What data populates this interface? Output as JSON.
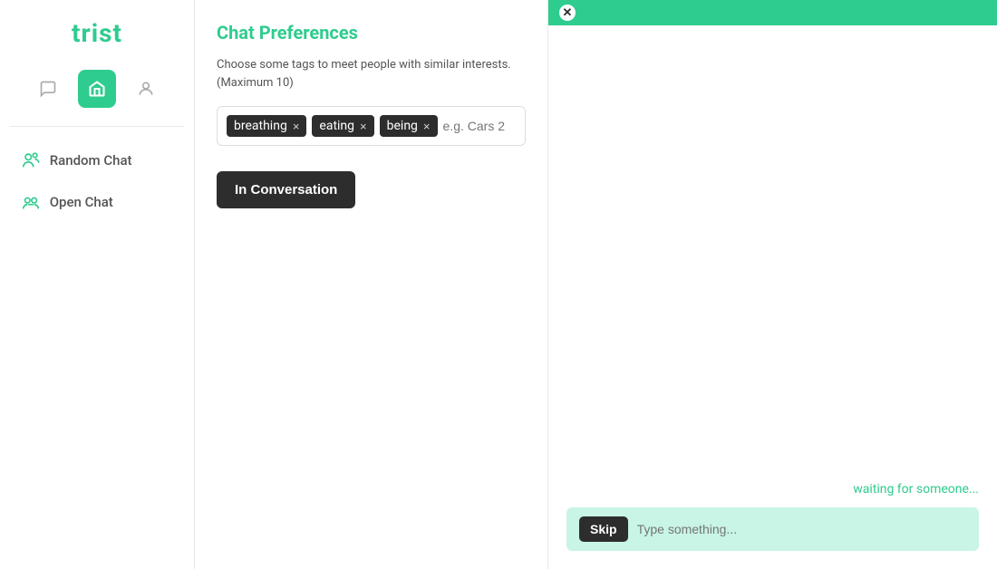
{
  "app": {
    "logo": "trist"
  },
  "sidebar": {
    "nav_items": [
      {
        "id": "random-chat",
        "label": "Random Chat",
        "icon": "user-chat-icon"
      },
      {
        "id": "open-chat",
        "label": "Open Chat",
        "icon": "group-chat-icon"
      }
    ]
  },
  "middle_panel": {
    "title": "Chat Preferences",
    "description": "Choose some tags to meet people with similar interests. (Maximum 10)",
    "tags": [
      {
        "id": "tag-breathing",
        "label": "breathing"
      },
      {
        "id": "tag-eating",
        "label": "eating"
      },
      {
        "id": "tag-being",
        "label": "being"
      }
    ],
    "tag_input_placeholder": "e.g. Cars 2",
    "conversation_button_label": "In Conversation"
  },
  "chat_panel": {
    "waiting_text": "waiting for someone...",
    "skip_button_label": "Skip",
    "chat_input_placeholder": "Type something..."
  }
}
